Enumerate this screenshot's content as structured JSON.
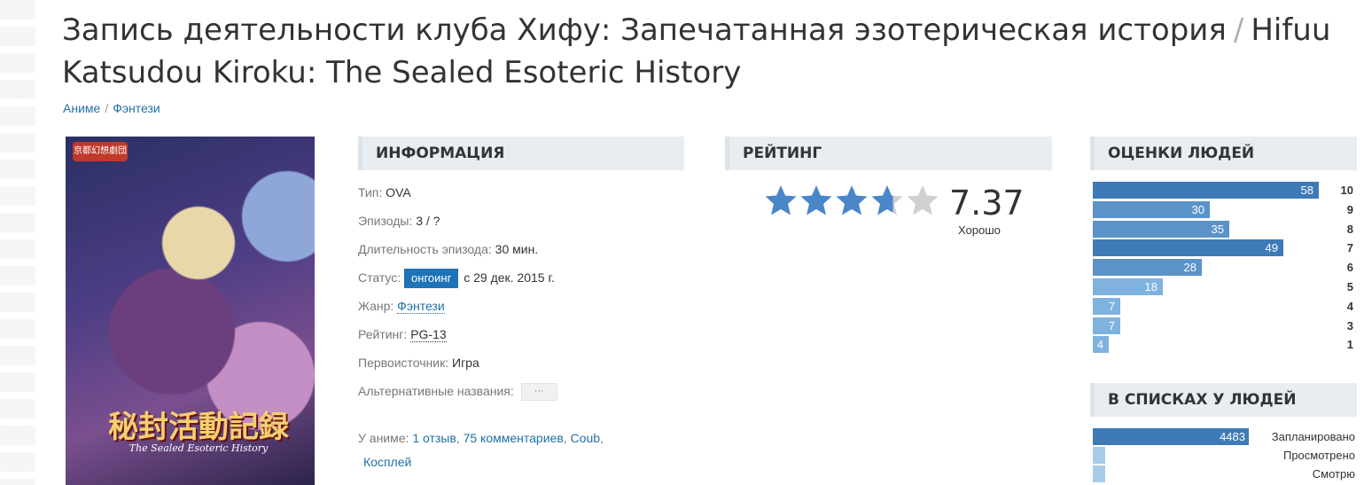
{
  "title": {
    "russian": "Запись деятельности клуба Хифу: Запечатанная эзотерическая история",
    "separator": "/",
    "english": "Hifuu Katsudou Kiroku: The Sealed Esoteric History"
  },
  "breadcrumbs": [
    "Аниме",
    "Фэнтези"
  ],
  "poster": {
    "logo_text": "京都幻想劇団",
    "title_text": "秘封活動記録",
    "subtitle_text": "The Sealed Esoteric History"
  },
  "info": {
    "heading": "ИНФОРМАЦИЯ",
    "type_label": "Тип:",
    "type_value": "OVA",
    "episodes_label": "Эпизоды:",
    "episodes_value": "3 / ?",
    "duration_label": "Длительность эпизода:",
    "duration_value": "30 мин.",
    "status_label": "Статус:",
    "status_badge": "онгоинг",
    "status_date": "с 29 дек. 2015 г.",
    "genre_label": "Жанр:",
    "genre_value": "Фэнтези",
    "rating_label": "Рейтинг:",
    "rating_value": "PG-13",
    "source_label": "Первоисточник:",
    "source_value": "Игра",
    "alt_names_label": "Альтернативные названия:",
    "alt_names_button": "···",
    "about_label": "У аниме:",
    "about_links": [
      "1 отзыв",
      "75 комментариев",
      "Coub",
      "Косплей"
    ]
  },
  "rating": {
    "heading": "РЕЙТИНГ",
    "value": "7.37",
    "text": "Хорошо",
    "stars_total": 5,
    "stars_filled": 3.685,
    "star_color": "#4a86c8",
    "star_empty_color": "#d0d0d0"
  },
  "scores": {
    "heading": "ОЦЕНКИ ЛЮДЕЙ",
    "max": 58,
    "items": [
      {
        "score": "10",
        "count": 58
      },
      {
        "score": "9",
        "count": 30
      },
      {
        "score": "8",
        "count": 35
      },
      {
        "score": "7",
        "count": 49
      },
      {
        "score": "6",
        "count": 28
      },
      {
        "score": "5",
        "count": 18
      },
      {
        "score": "4",
        "count": 7
      },
      {
        "score": "3",
        "count": 7
      },
      {
        "score": "1",
        "count": 4
      }
    ]
  },
  "lists": {
    "heading": "В СПИСКАХ У ЛЮДЕЙ",
    "items": [
      {
        "label": "Запланировано",
        "count": "4483",
        "fraction": 0.587
      },
      {
        "label": "Просмотрено",
        "count": "",
        "fraction": 0.048
      },
      {
        "label": "Смотрю",
        "count": "",
        "fraction": 0.048
      }
    ]
  }
}
